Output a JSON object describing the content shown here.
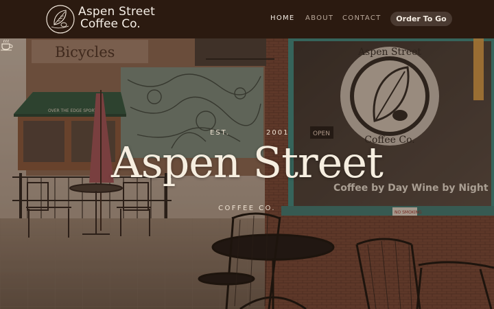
{
  "header": {
    "brand_line1": "Aspen Street",
    "brand_line2": "Coffee Co.",
    "nav": [
      {
        "label": "HOME"
      },
      {
        "label": "ABOUT"
      },
      {
        "label": "CONTACT"
      }
    ],
    "cta_label": "Order To Go"
  },
  "hero": {
    "est_left": "EST.",
    "est_year": "2001",
    "title": "Aspen Street",
    "subtitle": "COFFEE CO."
  },
  "scene": {
    "shop_sign_top": "Bicycles",
    "awning_text": "OVER THE EDGE SPORTS",
    "window_logo_top": "Aspen Street",
    "window_logo_bottom": "Coffee Co.",
    "window_banner": "Coffee by Day  Wine by Night",
    "open_sign": "OPEN",
    "no_smoking": "NO SMOKING"
  },
  "colors": {
    "header_bg": "#2b1a10",
    "cta_bg": "#4a3a31",
    "text_light": "#f6eee0"
  }
}
